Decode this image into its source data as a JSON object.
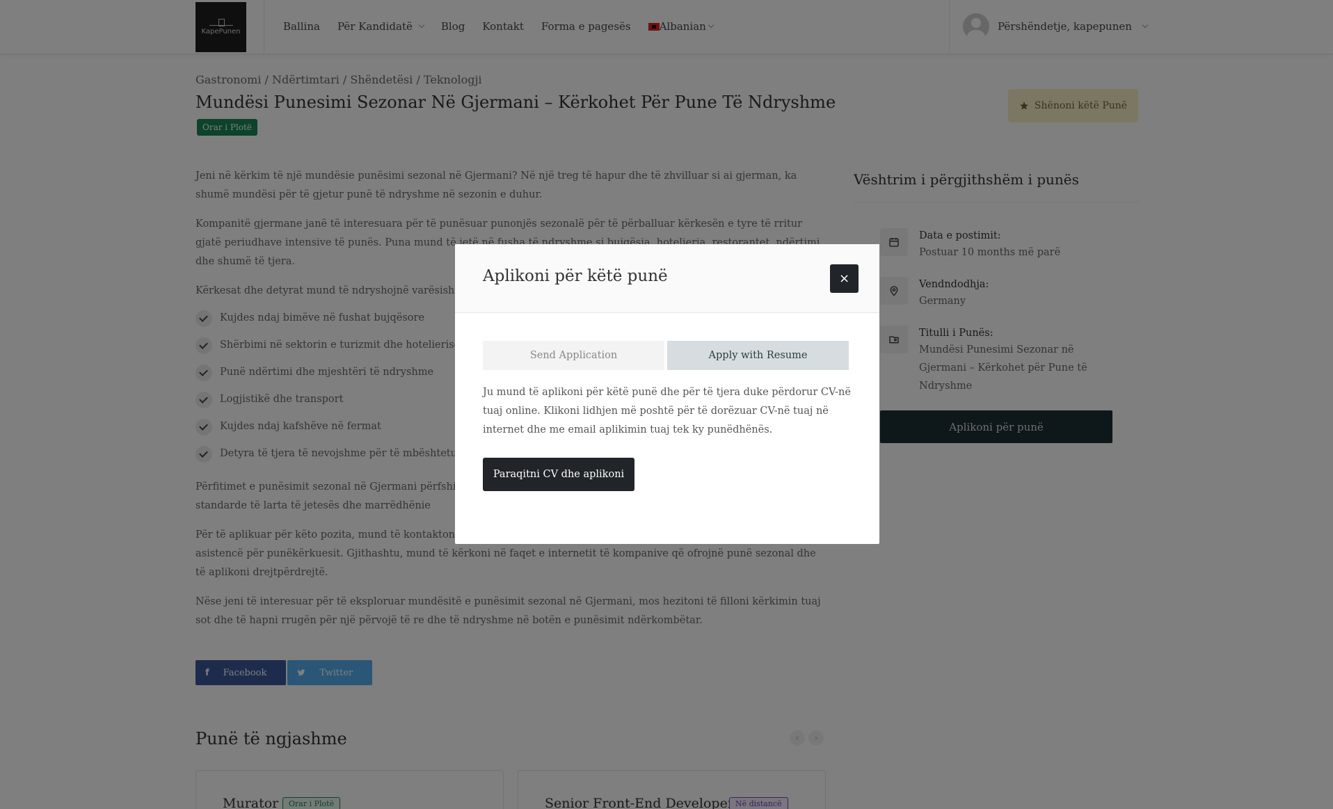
{
  "header": {
    "logo_text": "KapePunen",
    "nav": [
      {
        "label": "Ballina"
      },
      {
        "label": "Për Kandidatë"
      },
      {
        "label": "Blog"
      },
      {
        "label": "Kontakt"
      },
      {
        "label": "Forma e pagesës"
      },
      {
        "label": "Albanian"
      }
    ],
    "user_greeting": "Përshëndetje, kapepunen"
  },
  "job": {
    "breadcrumb": "Gastronomi / Ndërtimtari / Shëndetësi / Teknologji",
    "title": "Mundësi Punesimi Sezonar Në Gjermani – Kërkohet Për Pune Të Ndryshme",
    "type_badge": "Orar i Plotë",
    "bookmark_label": "Shënoni këtë Punë",
    "paragraphs": [
      "Jeni në kërkim të një mundësie punësimi sezonal në Gjermani? Në një treg të hapur dhe të zhvilluar si ai gjerman, ka shumë mundësi për të gjetur punë të ndryshme në sezonin e duhur.",
      "Kompanitë gjermane janë të interesuara për të punësuar punonjës sezonalë për të përballuar kërkesën e tyre të rritur gjatë periudhave intensive të punës. Puna mund të jetë në fusha të ndryshme si bujqësia, hotelieria, restorantet, ndërtimi, dhe shumë të tjera.",
      "Kërkesat dhe detyrat mund të ndryshojnë varësisht nga"
    ],
    "checklist": [
      "Kujdes ndaj bimëve në fushat bujqësore",
      "Shërbimi në sektorin e turizmit dhe hotelierisë",
      "Punë ndërtimi dhe mjeshtëri të ndryshme",
      "Logjistikë dhe transport",
      "Kujdes ndaj kafshëve në fermat",
      "Detyra të tjera të nevojshme për të mbështetur"
    ],
    "paragraphs_after": [
      "Përfitimet e punësimit sezonal në Gjermani përfshijnë e vlefshme në tregun e punës ndërkombëtar. Gjermania ofruar standarde të larta të jetesës dhe marrëdhënie",
      "Për të aplikuar për këto pozita, mund të kontaktoni agjencitë e punësimit lokal në Gjermani, të cilat ofrojnë shërbime dhe asistencë për punëkërkuesit. Gjithashtu, mund të kërkoni në faqet e internetit të kompanive që ofrojnë punë sezonal dhe të aplikoni drejtpërdrejtë.",
      "Nëse jeni të interesuar për të eksploruar mundësitë e punësimit sezonal në Gjermani, mos hezitoni të filloni kërkimin tuaj sot dhe të hapni rrugën për një përvojë të re dhe të ndryshme në botën e punësimit ndërkombëtar."
    ],
    "share": {
      "facebook": "Facebook",
      "twitter": "Twitter"
    }
  },
  "similar": {
    "title": "Punë të ngjashme",
    "jobs": [
      {
        "title": "Murator",
        "badge": "Orar i Plotë"
      },
      {
        "title": "Senior Front-End Developer",
        "badge": "Në distancë"
      }
    ]
  },
  "overview": {
    "title": "Vështrim i përgjithshëm i punës",
    "items": [
      {
        "label": "Data e postimit:",
        "value": "Postuar 10 months më parë",
        "icon": "calendar-icon"
      },
      {
        "label": "Vendndodhja:",
        "value": "Germany",
        "icon": "location-pin-icon"
      },
      {
        "label": "Titulli i Punës:",
        "value_lines": [
          "Mundësi Punesimi Sezonar në",
          "Gjermani – Kërkohet për Pune të",
          "Ndryshme"
        ],
        "icon": "folder-icon"
      }
    ],
    "apply_label": "Aplikoni për punë"
  },
  "modal": {
    "title": "Aplikoni për këtë punë",
    "close_icon": "×",
    "tabs": [
      {
        "label": "Send Application",
        "active": false
      },
      {
        "label": "Apply with Resume",
        "active": true
      }
    ],
    "text": "Ju mund të aplikoni për këtë punë dhe për të tjera duke përdorur CV-në tuaj online. Klikoni lidhjen më poshtë për të dorëzuar CV-në tuaj në internet dhe me email aplikimin tuaj tek ky punëdhënës.",
    "button_label": "Paraqitni CV dhe aplikoni"
  },
  "colors": {
    "badge_green": "#198754",
    "dark_button": "#212529",
    "apply_button": "#1d2e35",
    "bookmark_bg": "#f6eec4"
  }
}
